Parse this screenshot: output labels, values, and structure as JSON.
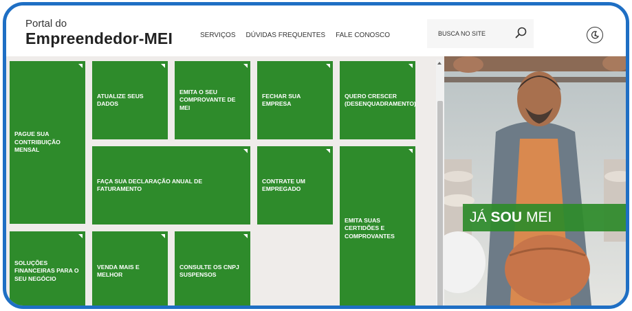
{
  "header": {
    "logo_line1": "Portal do",
    "logo_line2": "Empreendedor-MEI",
    "nav": [
      "SERVIÇOS",
      "DÚVIDAS FREQUENTES",
      "FALE CONOSCO"
    ],
    "search_placeholder": "BUSCA NO SITE"
  },
  "tiles": [
    {
      "label": "PAGUE SUA CONTRIBUIÇÃO MENSAL"
    },
    {
      "label": "ATUALIZE SEUS DADOS"
    },
    {
      "label": "EMITA O SEU COMPROVANTE DE MEI"
    },
    {
      "label": "FECHAR SUA EMPRESA"
    },
    {
      "label": "QUERO CRESCER (DESENQUADRAMENTO)"
    },
    {
      "label": "FAÇA SUA DECLARAÇÃO ANUAL DE FATURAMENTO"
    },
    {
      "label": "CONTRATE UM EMPREGADO"
    },
    {
      "label": "EMITA SUAS CERTIDÕES E COMPROVANTES"
    },
    {
      "label": "SOLUÇÕES FINANCEIRAS PARA O SEU NEGÓCIO"
    },
    {
      "label": "VENDA MAIS E MELHOR"
    },
    {
      "label": "CONSULTE OS CNPJ SUSPENSOS"
    }
  ],
  "hero": {
    "banner_pre": "JÁ",
    "banner_bold": "SOU",
    "banner_post": "MEI"
  },
  "colors": {
    "accent_green": "#2e8b2b",
    "frame_blue": "#1f6fc4"
  },
  "icons": {
    "search": "search-icon",
    "contrast": "contrast-icon"
  }
}
